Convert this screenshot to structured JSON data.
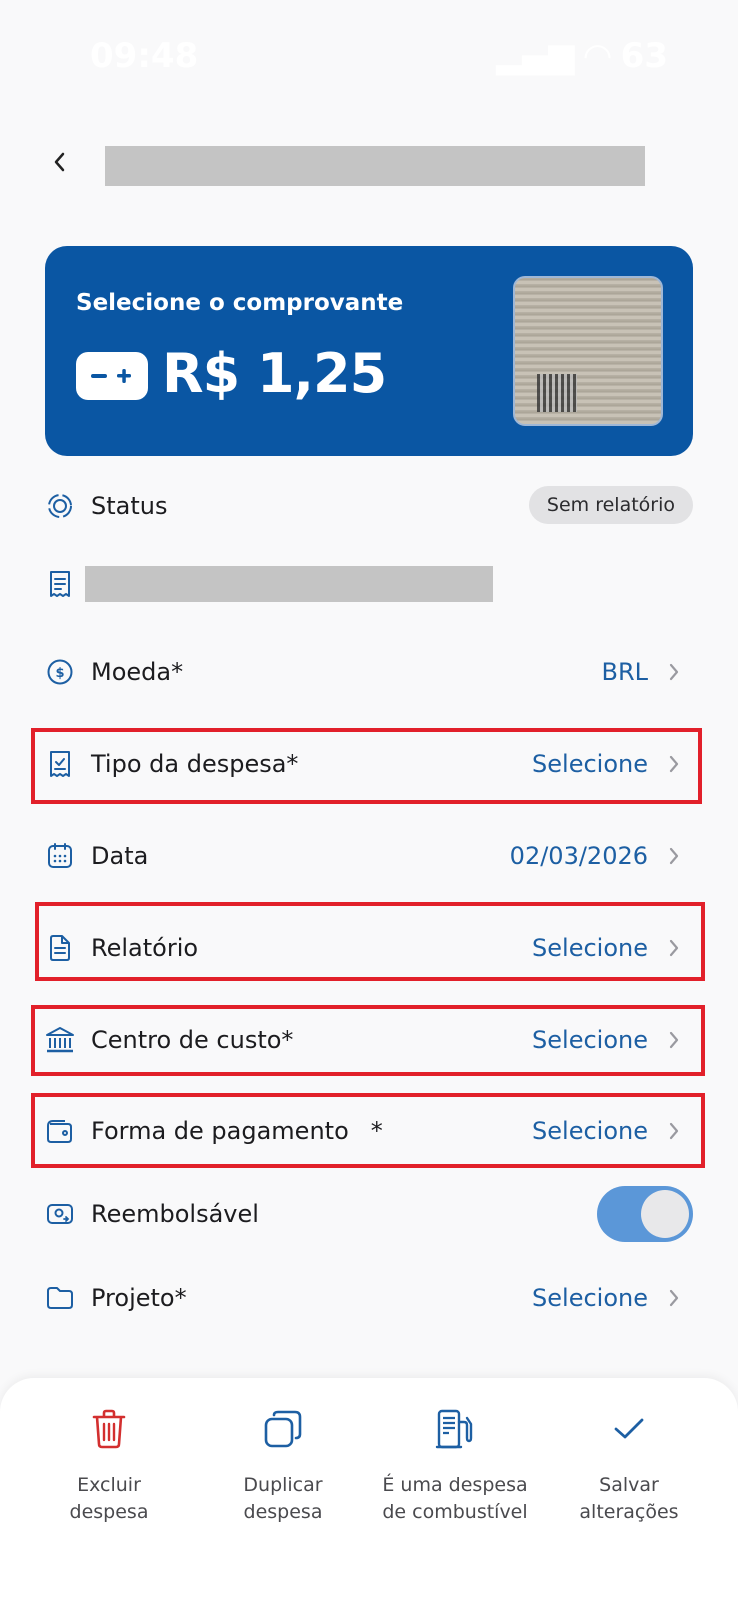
{
  "status_bar": {
    "time": "09:48",
    "battery": "63"
  },
  "card": {
    "label": "Selecione o comprovante",
    "amount": "R$ 1,25"
  },
  "fields": {
    "status": {
      "label": "Status",
      "value": "Sem relatório"
    },
    "moeda": {
      "label": "Moeda*",
      "value": "BRL"
    },
    "tipo": {
      "label": "Tipo da despesa*",
      "value": "Selecione"
    },
    "data": {
      "label": "Data",
      "value": "02/03/2026"
    },
    "relatorio": {
      "label": "Relatório",
      "value": "Selecione"
    },
    "centro": {
      "label": "Centro de custo*",
      "value": "Selecione"
    },
    "forma": {
      "label": "Forma de pagamento",
      "required_mark": "*",
      "value": "Selecione"
    },
    "reembolsavel": {
      "label": "Reembolsável",
      "enabled": true
    },
    "projeto": {
      "label": "Projeto*",
      "value": "Selecione"
    }
  },
  "actions": {
    "excluir": {
      "line1": "Excluir",
      "line2": "despesa"
    },
    "duplicar": {
      "line1": "Duplicar",
      "line2": "despesa"
    },
    "combustivel": {
      "line1": "É uma despesa",
      "line2": "de combustível"
    },
    "salvar": {
      "line1": "Salvar",
      "line2": "alterações"
    }
  },
  "colors": {
    "primary": "#0a56a3",
    "link": "#1d5fa3",
    "danger": "#d32f2f",
    "highlight": "#e2202a",
    "toggle_on": "#5b97d8"
  }
}
